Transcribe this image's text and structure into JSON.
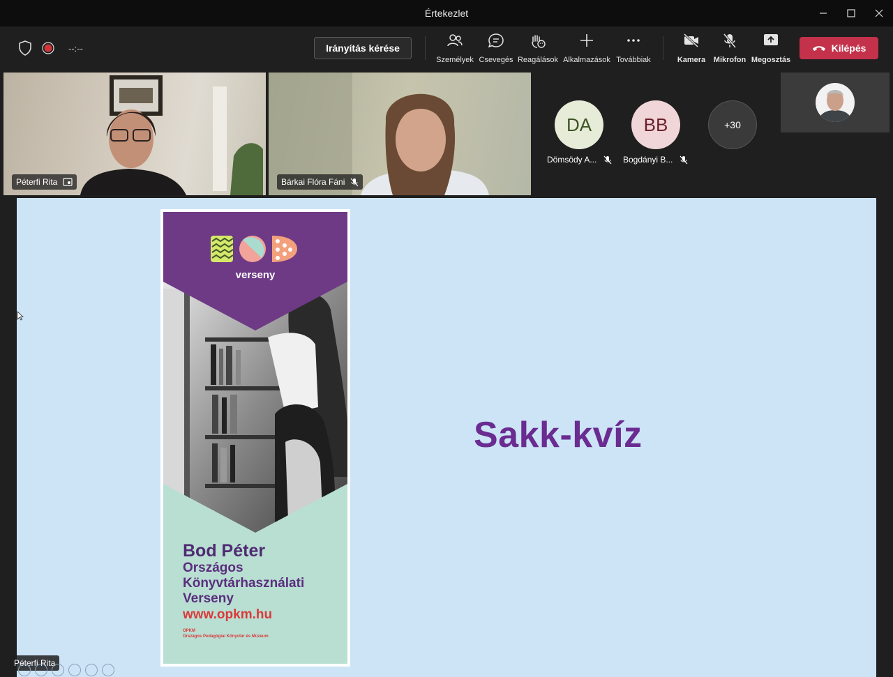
{
  "window": {
    "title": "Értekezlet"
  },
  "toolbar": {
    "timer": "--:--",
    "control_request": "Irányítás kérése",
    "people": "Személyek",
    "chat": "Csevegés",
    "reactions": "Reagálások",
    "apps": "Alkalmazások",
    "more": "Továbbiak",
    "camera": "Kamera",
    "mic": "Mikrofon",
    "share": "Megosztás",
    "leave": "Kilépés",
    "leave_color": "#c4314b"
  },
  "participants": {
    "video1_name": "Péterfi Rita",
    "video2_name": "Bárkai Flóra Fáni",
    "avatar1_initials": "DA",
    "avatar1_name": "Dömsödy A...",
    "avatar2_initials": "BB",
    "avatar2_name": "Bogdányi B...",
    "overflow_count": "+30"
  },
  "stage": {
    "slide_title": "Sakk-kvíz",
    "title_color": "#6a2c91",
    "background_color": "#cce4f6",
    "presenter": "Péterfi Rita",
    "banner": {
      "logo_word": "verseny",
      "heading_line1": "Bod Péter",
      "heading_line2": "Országos",
      "heading_line3": "Könyvtárhasználati",
      "heading_line4": "Verseny",
      "url": "www.opkm.hu",
      "org_abbr": "OPKM",
      "org_name": "Országos Pedagógiai Könyvtár és Múzeum"
    }
  }
}
